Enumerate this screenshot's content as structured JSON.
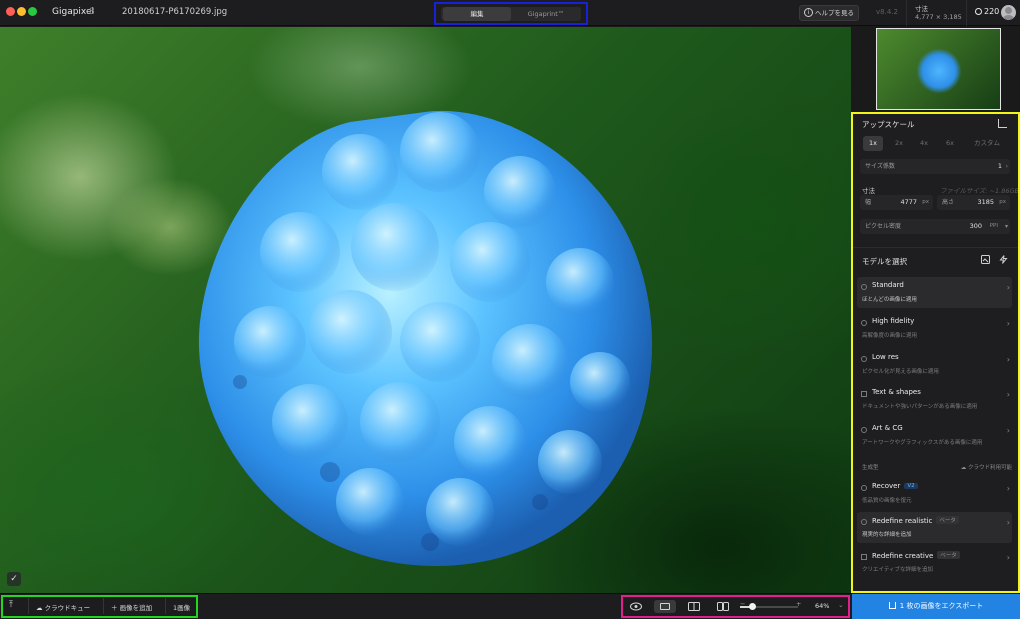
{
  "titlebar": {
    "app_name": "Gigapixel",
    "app_version": "8",
    "file_name": "20180617-P6170269.jpg",
    "mode_tabs": [
      {
        "label": "編集",
        "active": true
      },
      {
        "label": "Gigaprint™",
        "active": false
      }
    ],
    "help_label": "ヘルプを見る",
    "version": "v8.4.2",
    "dims_label": "寸法",
    "dims_value": "4,777 × 3,185",
    "credits": "220"
  },
  "canvas": {
    "check_icon": "checkmark-icon"
  },
  "upscale": {
    "title": "アップスケール",
    "scales": [
      {
        "label": "1x",
        "active": true
      },
      {
        "label": "2x",
        "active": false
      },
      {
        "label": "4x",
        "active": false
      },
      {
        "label": "6x",
        "active": false
      },
      {
        "label": "カスタム",
        "active": false
      }
    ],
    "size_factor_label": "サイズ係数",
    "size_factor_value": "1",
    "dims_label": "寸法",
    "file_size_label": "ファイルサイズ: ~1.86GB",
    "width_label": "幅",
    "width_value": "4777",
    "width_unit": "px",
    "height_label": "高さ",
    "height_value": "3185",
    "height_unit": "px",
    "density_label": "ピクセル密度",
    "density_value": "300",
    "density_unit": "PPI"
  },
  "models": {
    "title": "モデルを選択",
    "items": [
      {
        "name": "Standard",
        "desc": "ほとんどの画像に適用",
        "active": true,
        "badge": ""
      },
      {
        "name": "High fidelity",
        "desc": "高解像度の画像に適用",
        "active": false,
        "badge": ""
      },
      {
        "name": "Low res",
        "desc": "ピクセル化が見える画像に適用",
        "active": false,
        "badge": ""
      },
      {
        "name": "Text & shapes",
        "desc": "ドキュメントや強いパターンがある画像に適用",
        "active": false,
        "badge": ""
      },
      {
        "name": "Art & CG",
        "desc": "アートワークやグラフィックスがある画像に適用",
        "active": false,
        "badge": ""
      }
    ],
    "generative_label": "生成型",
    "cloud_label": "クラウド利用可能",
    "gen_items": [
      {
        "name": "Recover",
        "desc": "低品質の画像を復元",
        "active": false,
        "badge": "V2"
      },
      {
        "name": "Redefine realistic",
        "desc": "現実的な詳細を追加",
        "active": true,
        "badge": "ベータ"
      },
      {
        "name": "Redefine creative",
        "desc": "クリエイティブな詳細を追加",
        "active": false,
        "badge": "ベータ"
      }
    ]
  },
  "export_label": "1 枚の画像をエクスポート",
  "bottom": {
    "cloud_queue": "クラウドキュー",
    "add_image": "画像を追加",
    "image_count": "1画像",
    "zoom": "64%",
    "zoom_fraction": 0.2
  },
  "colors": {
    "accent": "#2383e2",
    "highlight_top": "#1820d8",
    "highlight_panel": "#f4f419",
    "highlight_bottom_left": "#22d622",
    "highlight_bottom_right": "#e0208c"
  }
}
